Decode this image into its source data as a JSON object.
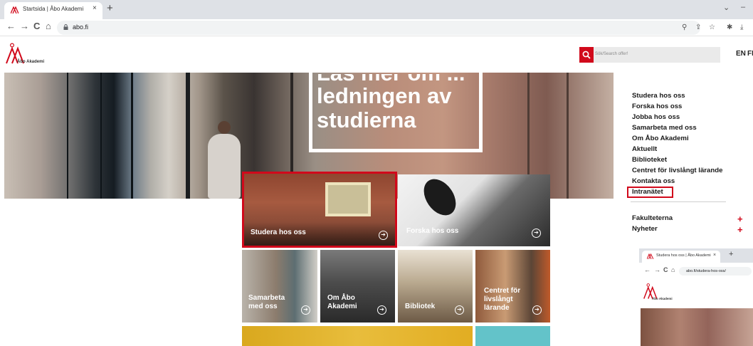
{
  "browser": {
    "tab_title": "Startsida | Åbo Akademi",
    "tab_close": "×",
    "new_tab": "+",
    "url": "abo.fi",
    "nav": {
      "back": "←",
      "forward": "→",
      "reload": "C",
      "home": "⌂"
    },
    "window_controls": {
      "menu": "⌄",
      "minimize": "–"
    },
    "toolbar_icons": {
      "zoom": "⚲",
      "share": "⇪",
      "bookmark": "☆",
      "extensions": "✱",
      "download": "⤓"
    }
  },
  "site": {
    "logo_text": "Åbo Akademi",
    "search_placeholder": "Sök/Search offer!",
    "languages": [
      "EN",
      "FI"
    ],
    "brand_color": "#d1091b",
    "hero": {
      "lines": [
        "Läs mer om ...",
        "ledningen av",
        "studierna"
      ]
    },
    "nav_menu": [
      "Studera hos oss",
      "Forska hos oss",
      "Jobba hos oss",
      "Samarbeta med oss",
      "Om Åbo Akademi",
      "Aktuellt",
      "Biblioteket",
      "Centret för livslångt lärande",
      "Kontakta oss",
      "Intranätet"
    ],
    "expandables": [
      {
        "label": "Fakulteterna",
        "icon": "+"
      },
      {
        "label": "Nyheter",
        "icon": "+"
      }
    ],
    "tiles": [
      {
        "label": "Studera hos oss",
        "arrow": "➔"
      },
      {
        "label": "Forska hos oss",
        "arrow": "➔"
      },
      {
        "label": "Samarbeta med oss",
        "arrow": "➔"
      },
      {
        "label": "Om Åbo Akademi",
        "arrow": "➔"
      },
      {
        "label": "Bibliotek",
        "arrow": "➔"
      },
      {
        "label": "Centret för livslångt lärande",
        "arrow": "➔"
      }
    ]
  },
  "inset": {
    "tab_title": "Studera hos oss | Åbo Akademi",
    "tab_close": "×",
    "new_tab": "+",
    "url": "abo.fi/studera-hos-oss/",
    "nav": {
      "back": "←",
      "forward": "→",
      "reload": "C",
      "home": "⌂"
    },
    "logo_text": "Åbo Akademi"
  }
}
